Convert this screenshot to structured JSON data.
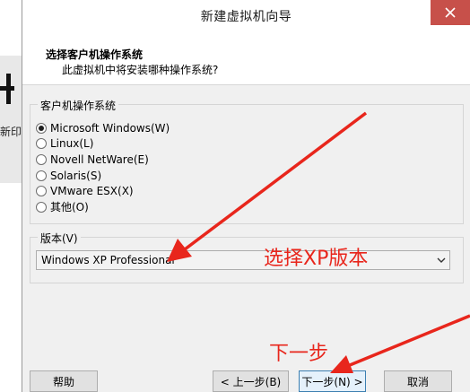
{
  "background": {
    "side_text": "新印"
  },
  "window": {
    "title": "新建虚拟机向导"
  },
  "header": {
    "title": "选择客户机操作系统",
    "subtitle": "此虚拟机中将安装哪种操作系统?"
  },
  "os_group": {
    "legend": "客户机操作系统",
    "options": [
      {
        "label": "Microsoft Windows(W)",
        "checked": true
      },
      {
        "label": "Linux(L)",
        "checked": false
      },
      {
        "label": "Novell NetWare(E)",
        "checked": false
      },
      {
        "label": "Solaris(S)",
        "checked": false
      },
      {
        "label": "VMware ESX(X)",
        "checked": false
      },
      {
        "label": "其他(O)",
        "checked": false
      }
    ]
  },
  "version_group": {
    "legend": "版本(V)",
    "selected": "Windows XP Professional"
  },
  "buttons": {
    "help": "帮助",
    "back": "< 上一步(B)",
    "next": "下一步(N) >",
    "cancel": "取消"
  },
  "annotations": {
    "select_xp": "选择XP版本",
    "next_step": "下一步",
    "color": "#e8261c"
  }
}
